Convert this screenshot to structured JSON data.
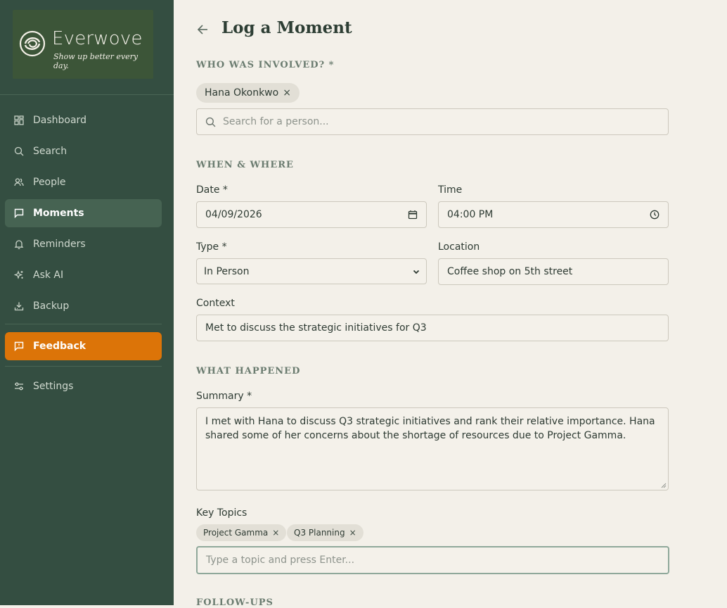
{
  "brand": {
    "name": "Everwove",
    "tagline": "Show up better every day."
  },
  "nav": {
    "items": [
      {
        "label": "Dashboard",
        "icon": "grid-icon"
      },
      {
        "label": "Search",
        "icon": "search-icon"
      },
      {
        "label": "People",
        "icon": "people-icon"
      },
      {
        "label": "Moments",
        "icon": "chat-icon",
        "active": true
      },
      {
        "label": "Reminders",
        "icon": "bell-icon"
      },
      {
        "label": "Ask AI",
        "icon": "sparkle-icon"
      },
      {
        "label": "Backup",
        "icon": "download-icon"
      }
    ],
    "feedback": "Feedback",
    "settings": "Settings"
  },
  "page": {
    "title": "Log a Moment"
  },
  "who": {
    "heading": "WHO WAS INVOLVED? *",
    "selected": [
      "Hana Okonkwo"
    ],
    "search_placeholder": "Search for a person..."
  },
  "when": {
    "heading": "WHEN & WHERE",
    "date_label": "Date *",
    "date_value": "04/09/2026",
    "time_label": "Time",
    "time_value": "04:00 PM",
    "type_label": "Type *",
    "type_value": "In Person",
    "location_label": "Location",
    "location_value": "Coffee shop on 5th street",
    "context_label": "Context",
    "context_value": "Met to discuss the strategic initiatives for Q3"
  },
  "happened": {
    "heading": "WHAT HAPPENED",
    "summary_label": "Summary *",
    "summary_value": "I met with Hana to discuss Q3 strategic initiatives and rank their relative importance. Hana shared some of her concerns about the shortage of resources due to Project Gamma.",
    "topics_label": "Key Topics",
    "topics": [
      "Project Gamma",
      "Q3 Planning"
    ],
    "topic_placeholder": "Type a topic and press Enter..."
  },
  "followups": {
    "heading": "FOLLOW-UPS"
  },
  "colors": {
    "sidebar": "#344e41",
    "accent": "#dc7408",
    "background": "#f3f0e9"
  }
}
